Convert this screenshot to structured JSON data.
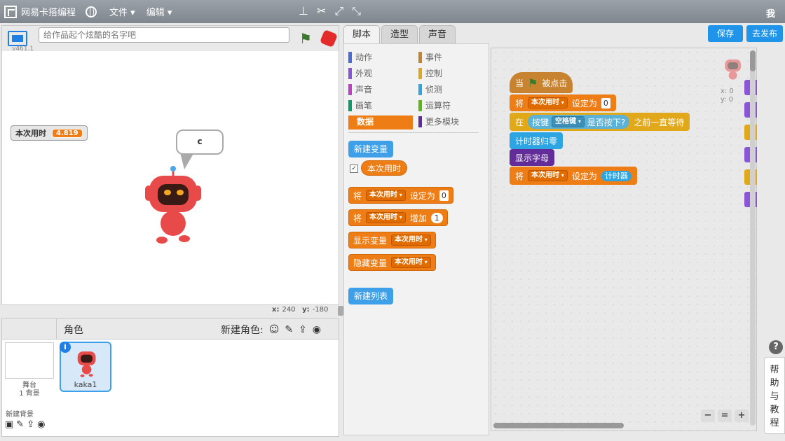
{
  "app": {
    "name": "网易卡搭编程",
    "me": "我"
  },
  "menu": {
    "file": "文件 ▾",
    "edit": "编辑 ▾"
  },
  "stage": {
    "version": "v461.1",
    "title_placeholder": "给作品起个炫酷的名字吧",
    "monitor_label": "本次用时",
    "monitor_value": "4.819",
    "speech": "c",
    "coord_x_label": "x:",
    "coord_x": "240",
    "coord_y_label": "y:",
    "coord_y": "-180"
  },
  "sprites": {
    "header": "角色",
    "new_sprite": "新建角色:",
    "stage_label": "舞台",
    "stage_bg_count": "1 背景",
    "new_backdrop": "新建背景",
    "sprite_name": "kaka1"
  },
  "tabs": [
    "脚本",
    "造型",
    "声音"
  ],
  "buttons": {
    "save": "保存",
    "publish": "去发布"
  },
  "categories": [
    {
      "label": "动作",
      "color": "#4a6cd4"
    },
    {
      "label": "事件",
      "color": "#c88330"
    },
    {
      "label": "外观",
      "color": "#8a55d7"
    },
    {
      "label": "控制",
      "color": "#e1a91a"
    },
    {
      "label": "声音",
      "color": "#bb42c3"
    },
    {
      "label": "侦测",
      "color": "#2ca5e2"
    },
    {
      "label": "画笔",
      "color": "#0e9a6c"
    },
    {
      "label": "运算符",
      "color": "#5cb712"
    },
    {
      "label": "数据",
      "color": "#ee7d16"
    },
    {
      "label": "更多模块",
      "color": "#632d99"
    }
  ],
  "palette": {
    "new_variable": "新建变量",
    "var_name": "本次用时",
    "set_label": "将",
    "set_to": "设定为",
    "set_value": "0",
    "change_by": "增加",
    "change_value": "1",
    "show_var": "显示变量",
    "hide_var": "隐藏变量",
    "new_list": "新建列表"
  },
  "script": {
    "when": "当",
    "clicked": "被点击",
    "set": "将",
    "var": "本次用时",
    "set_to": "设定为",
    "zero": "0",
    "wait_at": "在",
    "key_pressed": "按键",
    "key": "空格键",
    "is_pressed": "是否按下?",
    "wait_until": "之前一直等待",
    "reset_timer": "计时器归零",
    "show_letter": "显示字母",
    "timer": "计时器",
    "sprite_x": "x: 0",
    "sprite_y": "y: 0"
  },
  "help": {
    "q": "?",
    "label": "帮助与教程"
  },
  "colors": {
    "accent": "#1f94e8",
    "data_orange": "#ee7d16",
    "events_brown": "#c88330",
    "control_gold": "#e1a91a",
    "sensing_blue": "#2ca5e2",
    "looks_purple": "#8a55d7",
    "more_purple": "#632d99"
  }
}
